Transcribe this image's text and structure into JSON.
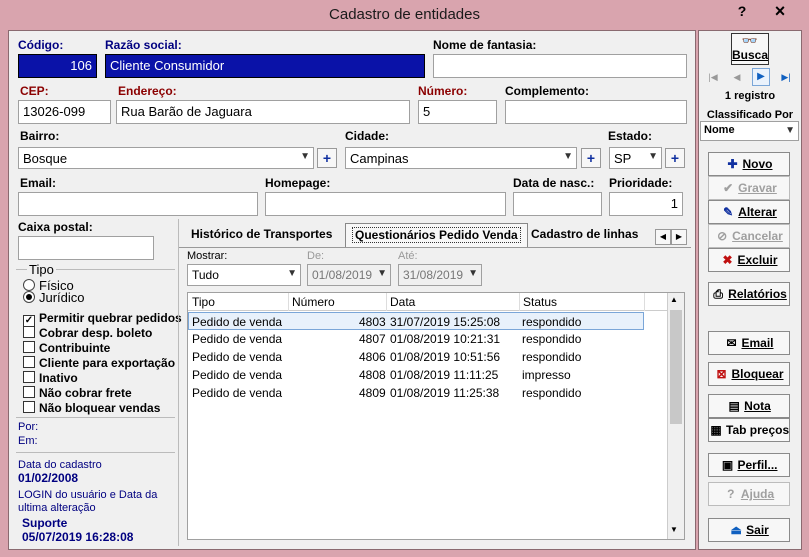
{
  "window": {
    "title": "Cadastro de entidades",
    "help": "?",
    "close": "×"
  },
  "form": {
    "codigo": {
      "label": "Código:",
      "value": "106"
    },
    "razao": {
      "label": "Razão social:",
      "value": "Cliente Consumidor"
    },
    "fantasia": {
      "label": "Nome de fantasia:",
      "value": ""
    },
    "cep": {
      "label": "CEP:",
      "value": "13026-099"
    },
    "endereco": {
      "label": "Endereço:",
      "value": "Rua Barão de Jaguara"
    },
    "numero": {
      "label": "Número:",
      "value": "5"
    },
    "complemento": {
      "label": "Complemento:",
      "value": ""
    },
    "bairro": {
      "label": "Bairro:",
      "value": "Bosque"
    },
    "cidade": {
      "label": "Cidade:",
      "value": "Campinas"
    },
    "estado": {
      "label": "Estado:",
      "value": "SP"
    },
    "email": {
      "label": "Email:",
      "value": ""
    },
    "homepage": {
      "label": "Homepage:",
      "value": ""
    },
    "nasc": {
      "label": "Data de nasc.:",
      "value": ""
    },
    "prioridade": {
      "label": "Prioridade:",
      "value": "1"
    },
    "caixa": {
      "label": "Caixa postal:",
      "value": ""
    }
  },
  "tipo": {
    "label": "Tipo",
    "options": [
      "Físico",
      "Jurídico"
    ],
    "selected": "Jurídico"
  },
  "checks": [
    {
      "label": "Permitir quebrar pedidos",
      "checked": true
    },
    {
      "label": "Cobrar desp. boleto",
      "checked": false
    },
    {
      "label": "Contribuinte",
      "checked": false
    },
    {
      "label": "Cliente para exportação",
      "checked": false
    },
    {
      "label": "Inativo",
      "checked": false
    },
    {
      "label": "Não cobrar frete",
      "checked": false
    },
    {
      "label": "Não bloquear vendas",
      "checked": false
    }
  ],
  "por": "Por:",
  "em": "Em:",
  "cadastro": {
    "label": "Data do cadastro",
    "value": "01/02/2008"
  },
  "login": {
    "label1": "LOGIN do usuário e Data da",
    "label2": "ultima alteração",
    "user": "Suporte",
    "date": "05/07/2019 16:28:08"
  },
  "tabs": [
    "Histórico de Transportes",
    "Questionários Pedido Venda",
    "Cadastro de linhas"
  ],
  "filter": {
    "mostrar": {
      "label": "Mostrar:",
      "value": "Tudo"
    },
    "de": {
      "label": "De:",
      "value": "01/08/2019"
    },
    "ate": {
      "label": "Até:",
      "value": "31/08/2019"
    }
  },
  "table": {
    "headers": [
      "Tipo",
      "Número",
      "Data",
      "Status"
    ],
    "rows": [
      [
        "Pedido de venda",
        "4803",
        "31/07/2019 15:25:08",
        "respondido"
      ],
      [
        "Pedido de venda",
        "4807",
        "01/08/2019 10:21:31",
        "respondido"
      ],
      [
        "Pedido de venda",
        "4806",
        "01/08/2019 10:51:56",
        "respondido"
      ],
      [
        "Pedido de venda",
        "4808",
        "01/08/2019 11:11:25",
        "impresso"
      ],
      [
        "Pedido de venda",
        "4809",
        "01/08/2019 11:25:38",
        "respondido"
      ]
    ]
  },
  "side": {
    "busca": "Busca",
    "registro": "1 registro",
    "classificado": "Classificado Por",
    "ordem": "Nome",
    "buttons": {
      "novo": "Novo",
      "gravar": "Gravar",
      "alterar": "Alterar",
      "cancelar": "Cancelar",
      "excluir": "Excluir",
      "relatorios": "Relatórios",
      "email": "Email",
      "bloquear": "Bloquear",
      "nota": "Nota",
      "tabprecos": "Tab preços",
      "perfil": "Perfil...",
      "ajuda": "Ajuda",
      "sair": "Sair"
    }
  },
  "colors": {
    "titlebar": "#d9a4ae",
    "selection": "#0a12a8",
    "accent": "#000080"
  }
}
